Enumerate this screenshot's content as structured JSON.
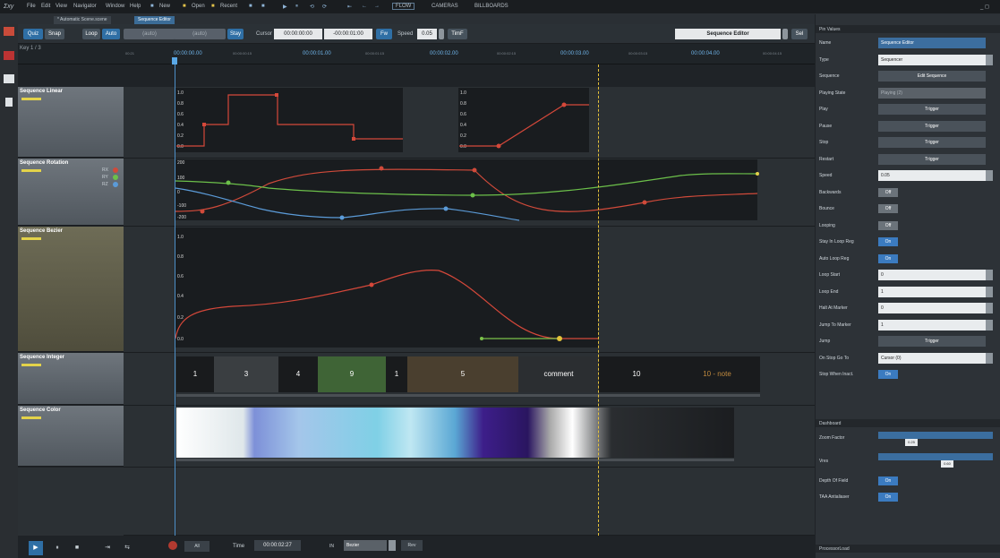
{
  "menu": {
    "logo": "Ʃxy",
    "items": [
      "File",
      "Edit",
      "View",
      "Navigator",
      "Window",
      "Help",
      "New",
      "Open",
      "Recent"
    ],
    "right_items": [
      "FLOW",
      "CAMERAS",
      "BILLBOARDS"
    ],
    "window_controls": "_ ◻"
  },
  "tabs": [
    "* Automatic Scene.scene",
    "Sequence Editor"
  ],
  "toolbar": {
    "quiz": "Quiz",
    "snap": "Snap",
    "loop": "Loop",
    "auto": "Auto",
    "auto1": "(auto)",
    "auto2": "(auto)",
    "stay": "Stay",
    "cursor_label": "Cursor",
    "cursor_value": "00:00:00:00",
    "offset_value": "-00:00:01:00",
    "fw": "Fw",
    "speed_label": "Speed",
    "speed_value": "0.05",
    "timef": "TimF",
    "editor_name": "Sequence Editor",
    "sel": "Sel"
  },
  "ruler": {
    "left_label": "Key 1 / 3",
    "labels": [
      "00:00:00.00",
      "00:00:01.00",
      "00:00:02.00",
      "00:00:03.00",
      "00:00:04.00"
    ],
    "minor_labels": [
      "00:21",
      "00:00:00:15",
      "00:00:01:15",
      "00:00:02:15",
      "00:00:03:15",
      "00:00:04:15"
    ]
  },
  "tracks": {
    "linear": {
      "name": "Sequence Linear",
      "yticks": [
        "1.0",
        "0.8",
        "0.6",
        "0.4",
        "0.2",
        "0.0"
      ]
    },
    "rotation": {
      "name": "Sequence Rotation",
      "rx": "RX",
      "ry": "RY",
      "rz": "RZ",
      "yticks": [
        "200",
        "100",
        "0",
        "-100",
        "-200"
      ]
    },
    "bezier": {
      "name": "Sequence Bezier",
      "yticks": [
        "1.0",
        "0.8",
        "0.6",
        "0.4",
        "0.2",
        "0.0"
      ]
    },
    "integer": {
      "name": "Sequence Integer",
      "segments": [
        "1",
        "3",
        "4",
        "9",
        "1",
        "5",
        "comment",
        "10",
        "10 - note"
      ]
    },
    "color": {
      "name": "Sequence Color"
    }
  },
  "bottom": {
    "time_label": "Time",
    "time_value": "00:00:02:27",
    "in_label": "IN",
    "interp": "Bezier",
    "rev": "Rev",
    "all": "All"
  },
  "panel": {
    "title": "Pin Values",
    "rows": [
      {
        "label": "Name",
        "value": "Sequence Editor",
        "kind": "blue"
      },
      {
        "label": "Type",
        "value": "Sequencer",
        "kind": "white"
      },
      {
        "label": "Sequence",
        "value": "Edit Sequence",
        "kind": "trig"
      },
      {
        "label": "Playing State",
        "value": "Playing (2)",
        "kind": "grey"
      },
      {
        "label": "Play",
        "value": "Trigger",
        "kind": "trig"
      },
      {
        "label": "Pause",
        "value": "Trigger",
        "kind": "trig"
      },
      {
        "label": "Stop",
        "value": "Trigger",
        "kind": "trig"
      },
      {
        "label": "Restart",
        "value": "Trigger",
        "kind": "trig"
      },
      {
        "label": "Speed",
        "value": "0.05",
        "kind": "white"
      },
      {
        "label": "Backwards",
        "value": "Off",
        "kind": "toggle"
      },
      {
        "label": "Bounce",
        "value": "Off",
        "kind": "toggle"
      },
      {
        "label": "Looping",
        "value": "Off",
        "kind": "toggle"
      },
      {
        "label": "Stay In Loop Reg",
        "value": "On",
        "kind": "toggle-on"
      },
      {
        "label": "Auto Loop Reg",
        "value": "On",
        "kind": "toggle-on"
      },
      {
        "label": "Loop Start",
        "value": "0",
        "kind": "white"
      },
      {
        "label": "Loop End",
        "value": "1",
        "kind": "white"
      },
      {
        "label": "Halt At Marker",
        "value": "0",
        "kind": "white"
      },
      {
        "label": "Jump To Marker",
        "value": "1",
        "kind": "white"
      },
      {
        "label": "Jump",
        "value": "Trigger",
        "kind": "trig"
      },
      {
        "label": "On Stop Go To",
        "value": "Cursor (0)",
        "kind": "white"
      },
      {
        "label": "Stop When Inact.",
        "value": "On",
        "kind": "toggle-on"
      }
    ],
    "dashboard_title": "Dashboard",
    "zoom_label": "Zoom Factor",
    "zoom_value": "0.25",
    "vres_label": "Vres",
    "vres_value": "0.60",
    "dof_label": "Depth Of Field",
    "dof_value": "On",
    "taa_label": "TAA Antialiaser",
    "taa_value": "On",
    "processor_title": "ProcessorLoad"
  }
}
